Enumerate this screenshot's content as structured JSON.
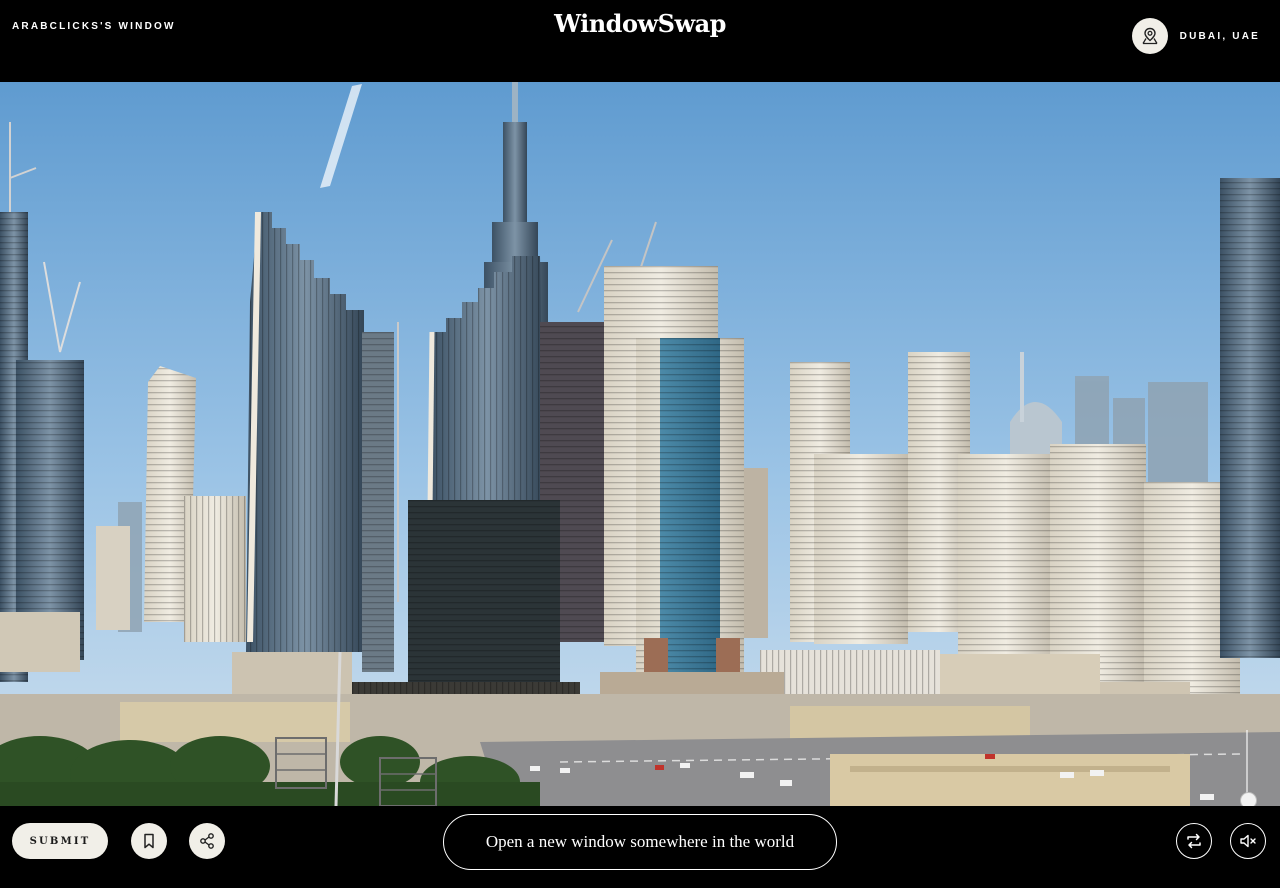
{
  "header": {
    "window_owner": "ARABCLICKS'S WINDOW",
    "brand": "WindowSwap",
    "location": "DUBAI, UAE"
  },
  "footer": {
    "submit_label": "SUBMIT",
    "open_window_label": "Open a new window somewhere in the world"
  },
  "icons": {
    "location": "map-pin-icon",
    "bookmark": "bookmark-icon",
    "share": "share-icon",
    "swap": "swap-arrows-icon",
    "mute": "speaker-muted-icon"
  },
  "colors": {
    "background": "#000000",
    "button_light": "#f1efe8",
    "sky": "#7fb0dc"
  },
  "media": {
    "volume_level": 0.0
  }
}
